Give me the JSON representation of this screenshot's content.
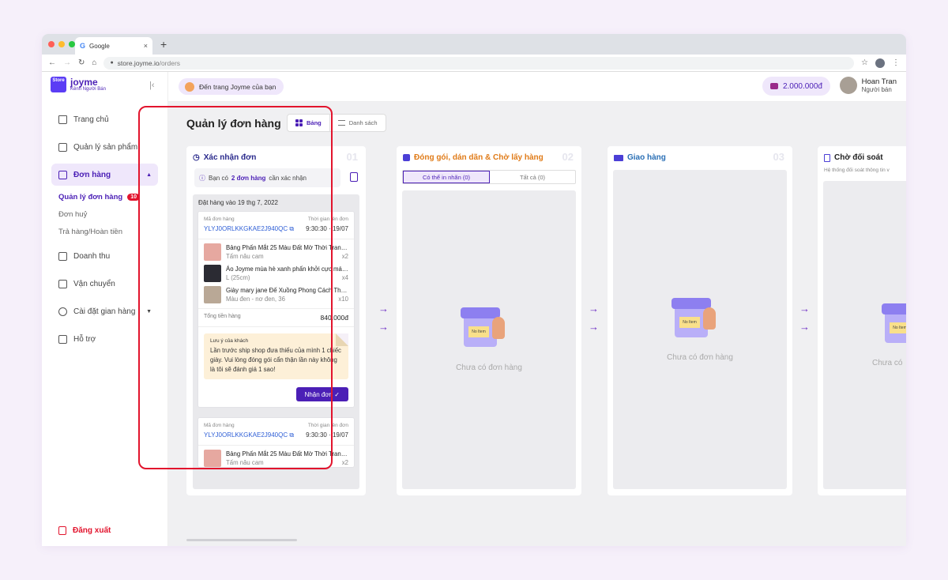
{
  "browser": {
    "tab_title": "Google",
    "url_host": "store.joyme.io",
    "url_path": "/orders",
    "new_tab": "+",
    "tab_close": "×"
  },
  "sidebar": {
    "brand": "joyme",
    "brand_sub": "Kênh Người Bán",
    "logo_text": "Store",
    "items": [
      {
        "label": "Trang chủ",
        "icon": "home-icon"
      },
      {
        "label": "Quản lý sản phẩm",
        "icon": "box-icon"
      },
      {
        "label": "Đơn hàng",
        "icon": "clipboard-icon"
      }
    ],
    "orders_sub": [
      {
        "label": "Quản lý đơn hàng",
        "badge": "10"
      },
      {
        "label": "Đơn huỷ"
      },
      {
        "label": "Trả hàng/Hoàn tiền"
      }
    ],
    "items2": [
      {
        "label": "Doanh thu",
        "icon": "revenue-icon"
      },
      {
        "label": "Vận chuyển",
        "icon": "truck-icon"
      },
      {
        "label": "Cài đặt gian hàng",
        "icon": "gear-icon"
      },
      {
        "label": "Hỗ trợ",
        "icon": "help-icon"
      }
    ],
    "logout": "Đăng xuất"
  },
  "topbar": {
    "visit_label": "Đến trang Joyme của bạn",
    "balance": "2.000.000đ",
    "user_name": "Hoan Tran",
    "user_role": "Người bán"
  },
  "page": {
    "title": "Quản lý đơn hàng",
    "view_board": "Bảng",
    "view_list": "Danh sách"
  },
  "columns": [
    {
      "title": "Xác nhận đơn",
      "num": "01",
      "color": "#2a2a8c"
    },
    {
      "title": "Đóng gói, dán dãn & Chờ lấy hàng",
      "num": "02",
      "color": "#e07b18"
    },
    {
      "title": "Giao hàng",
      "num": "03",
      "color": "#2a6fb5"
    },
    {
      "title": "Chờ đối soát",
      "num": "",
      "color": "#222"
    }
  ],
  "confirm": {
    "banner_pre": "Bạn có",
    "banner_count": "2 đơn hàng",
    "banner_post": "cần xác nhận",
    "date_pre": "Đặt hàng vào",
    "date": "19 thg 7, 2022"
  },
  "orders": [
    {
      "code_label": "Mã đơn hàng",
      "time_label": "Thời gian lên đơn",
      "code": "YLYJ0ORLKKGKAE2J940QC",
      "time": "9:30:30",
      "date": "19/07",
      "items": [
        {
          "name": "Bảng Phấn Mắt 25 Màu Đất Mờ Thời Trang...",
          "variant": "Tấm nâu cam",
          "qty": "x2"
        },
        {
          "name": "Áo Joyme mùa hè xanh phấn khởi cực mát...",
          "variant": "L (25cm)",
          "qty": "x4"
        },
        {
          "name": "Giày mary jane Đế Xuồng Phong Cách Thời...",
          "variant": "Màu đen - nơ đen, 36",
          "qty": "x10"
        }
      ],
      "total_label": "Tổng tiền hàng",
      "total": "840.000đ",
      "note_title": "Lưu ý của khách",
      "note": "Lần trước ship shop đưa thiếu của mình 1 chiếc giày. Vui lòng đóng gói cẩn thận lần này không là tôi sẽ đánh giá 1 sao!",
      "accept": "Nhận đơn ✓"
    },
    {
      "code_label": "Mã đơn hàng",
      "time_label": "Thời gian lên đơn",
      "code": "YLYJ0ORLKKGKAE2J940QC",
      "time": "9:30:30",
      "date": "19/07",
      "items": [
        {
          "name": "Bảng Phấn Mắt 25 Màu Đất Mờ Thời Trang...",
          "variant": "Tấm nâu cam",
          "qty": "x2"
        }
      ]
    }
  ],
  "pack": {
    "tab_print": "Có thể in nhãn (0)",
    "tab_all": "Tất cả  (0)",
    "empty": "Chưa có đơn hàng"
  },
  "ship": {
    "empty": "Chưa có đơn hàng"
  },
  "reconcile": {
    "subtitle": "Hệ thống đối soát thông tin v",
    "empty": "Chưa có"
  },
  "store_sign": "No Item",
  "arrow": "→"
}
